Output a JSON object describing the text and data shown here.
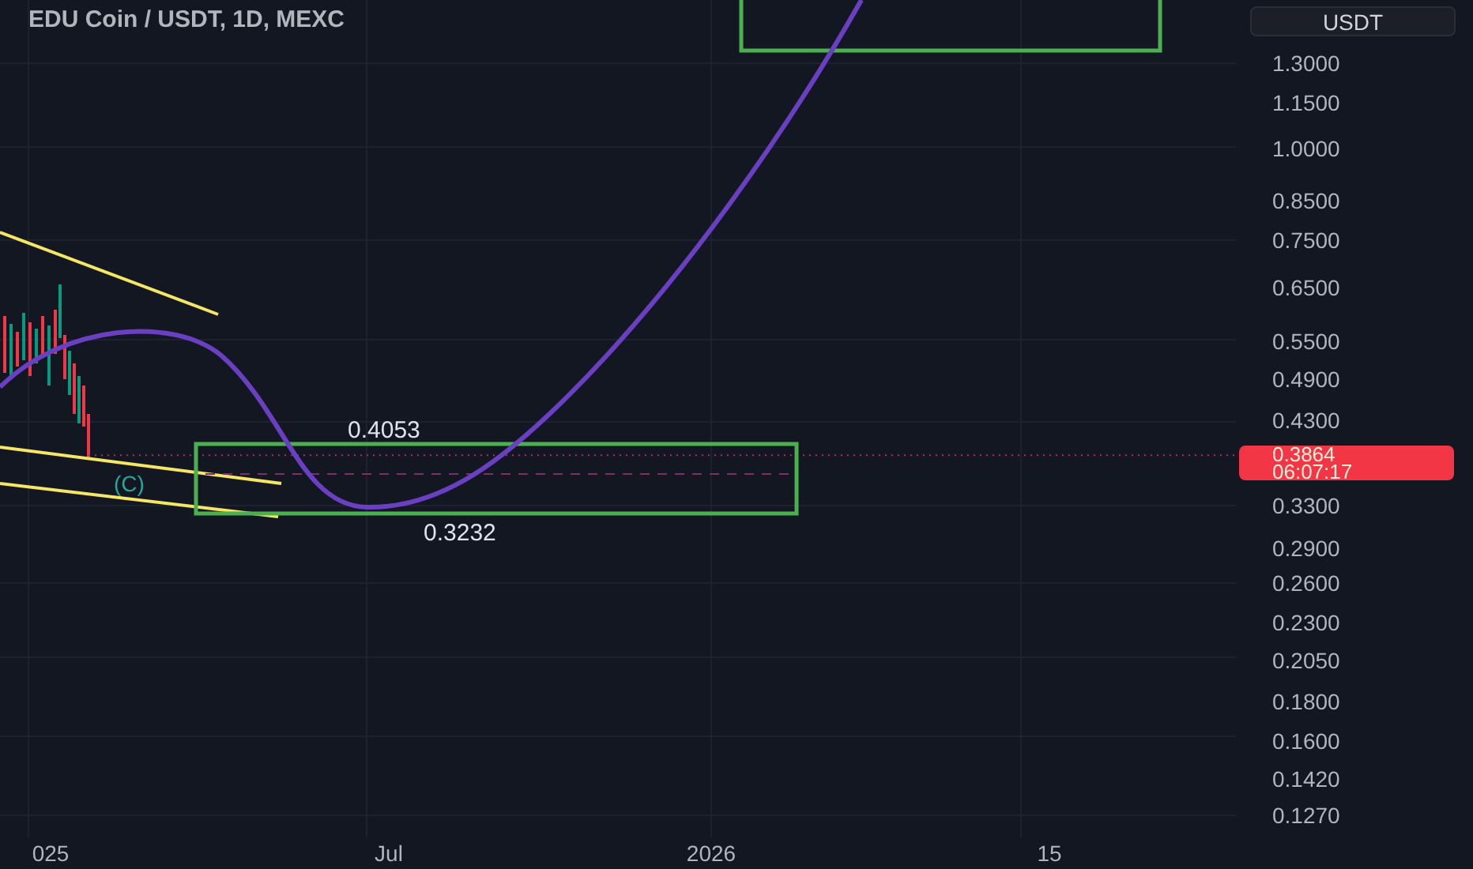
{
  "chart": {
    "title": "EDU Coin / USDT, 1D, MEXC",
    "wave_label": "(C)",
    "box_labels": [
      {
        "text": "0.4053",
        "kind": "top"
      },
      {
        "text": "0.3232",
        "kind": "bottom"
      }
    ]
  },
  "price_axis": {
    "currency_button": "USDT",
    "ticks": [
      "1.3000",
      "1.1500",
      "1.0000",
      "0.8500",
      "0.7500",
      "0.6500",
      "0.5500",
      "0.4900",
      "0.4300",
      "0.3300",
      "0.2900",
      "0.2600",
      "0.2300",
      "0.2050",
      "0.1800",
      "0.1600",
      "0.1420",
      "0.1270"
    ],
    "last_price": {
      "value": "0.3864",
      "countdown": "06:07:17"
    }
  },
  "time_axis": {
    "labels": [
      "025",
      "Jul",
      "2026",
      "15"
    ]
  }
}
